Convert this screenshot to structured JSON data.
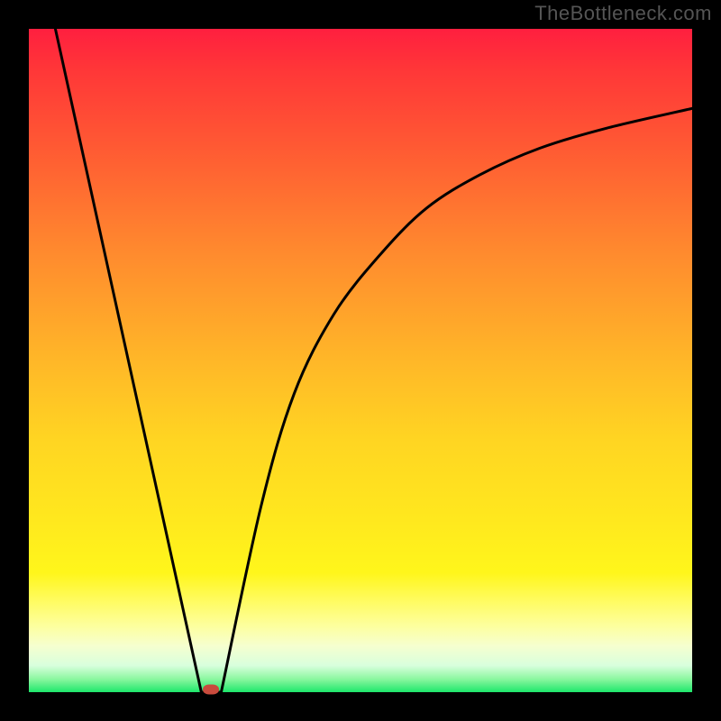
{
  "watermark_text": "TheBottleneck.com",
  "chart_data": {
    "type": "line",
    "title": "",
    "xlabel": "",
    "ylabel": "",
    "x_range": [
      0,
      100
    ],
    "y_range": [
      0,
      100
    ],
    "series": [
      {
        "name": "left-segment",
        "shape": "linear",
        "x": [
          4,
          26
        ],
        "y": [
          100,
          0
        ]
      },
      {
        "name": "right-segment",
        "shape": "concave-increasing",
        "x": [
          29,
          35,
          40,
          46,
          53,
          60,
          68,
          77,
          87,
          100
        ],
        "y": [
          0,
          28,
          45,
          57,
          66,
          73,
          78,
          82,
          85,
          88
        ]
      }
    ],
    "minimum_marker": {
      "x": 27.5,
      "y": 0
    },
    "background_gradient": {
      "direction": "vertical",
      "stops": [
        {
          "pos": 0.0,
          "color": "#ff1f3f"
        },
        {
          "pos": 0.5,
          "color": "#ffb728"
        },
        {
          "pos": 0.82,
          "color": "#fff61b"
        },
        {
          "pos": 1.0,
          "color": "#1de76b"
        }
      ]
    }
  },
  "colors": {
    "curve": "#000000",
    "marker": "#c94b3d",
    "frame": "#000000"
  }
}
